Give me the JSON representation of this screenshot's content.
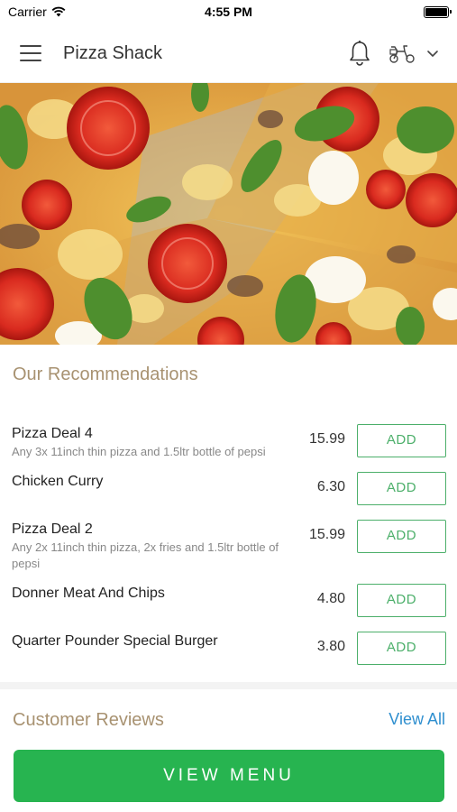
{
  "status": {
    "carrier": "Carrier",
    "time": "4:55 PM"
  },
  "header": {
    "title": "Pizza Shack",
    "icons": [
      "menu-icon",
      "bell-icon",
      "delivery-scooter-icon",
      "chevron-down-icon"
    ]
  },
  "recommendations": {
    "title": "Our Recommendations",
    "items": [
      {
        "name": "Pizza Deal 4",
        "description": "Any 3x 11inch thin pizza and 1.5ltr bottle of pepsi",
        "price": "15.99",
        "add_label": "ADD"
      },
      {
        "name": "Chicken Curry",
        "description": "",
        "price": "6.30",
        "add_label": "ADD"
      },
      {
        "name": "Pizza Deal 2",
        "description": "Any 2x 11inch thin pizza, 2x fries and 1.5ltr bottle of pepsi",
        "price": "15.99",
        "add_label": "ADD"
      },
      {
        "name": "Donner Meat And Chips",
        "description": "",
        "price": "4.80",
        "add_label": "ADD"
      },
      {
        "name": "Quarter Pounder Special Burger",
        "description": "",
        "price": "3.80",
        "add_label": "ADD"
      }
    ]
  },
  "reviews": {
    "title": "Customer Reviews",
    "view_all_label": "View All"
  },
  "cta": {
    "label": "VIEW MENU"
  },
  "colors": {
    "accent_green": "#27b450",
    "link_blue": "#2f8fcf",
    "section_title": "#a89271"
  }
}
